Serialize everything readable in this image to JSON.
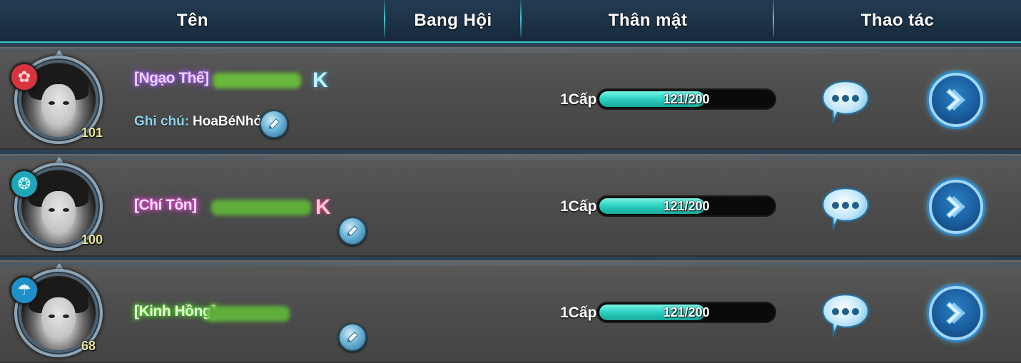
{
  "header": {
    "col_name": "Tên",
    "col_guild": "Bang Hội",
    "col_intimacy": "Thân mật",
    "col_actions": "Thao tác"
  },
  "colors": {
    "intimacy_fill": "#2fd3c4",
    "header_accent": "#2ec6c8",
    "row_bg": "#4d4d4d"
  },
  "friends": [
    {
      "title": "[Ngạo Thế]",
      "title_color": "#b56bff",
      "k_badge": "K",
      "k_color": "#7ee6ff",
      "note_label": "Ghi chú:",
      "note_value": "HoaBéNhỏ",
      "level": "101",
      "sect_icon": "flower-emblem-icon",
      "sect_color": "#d8343f",
      "intimacy_level": "1Cấp",
      "intimacy_text": "121/200",
      "intimacy_fraction": 0.605
    },
    {
      "title": "[Chí Tôn]",
      "title_color": "#ff5cf0",
      "k_badge": "K",
      "k_color": "#ff6fa8",
      "note_label": "",
      "note_value": "",
      "level": "100",
      "sect_icon": "spiral-emblem-icon",
      "sect_color": "#1fa6b8",
      "intimacy_level": "1Cấp",
      "intimacy_text": "121/200",
      "intimacy_fraction": 0.605
    },
    {
      "title": "[Kinh Hồng]",
      "title_color": "#6dff3c",
      "k_badge": "",
      "k_color": "",
      "note_label": "",
      "note_value": "",
      "level": "68",
      "sect_icon": "umbrella-emblem-icon",
      "sect_color": "#1f8fc9",
      "intimacy_level": "1Cấp",
      "intimacy_text": "121/200",
      "intimacy_fraction": 0.605
    }
  ]
}
